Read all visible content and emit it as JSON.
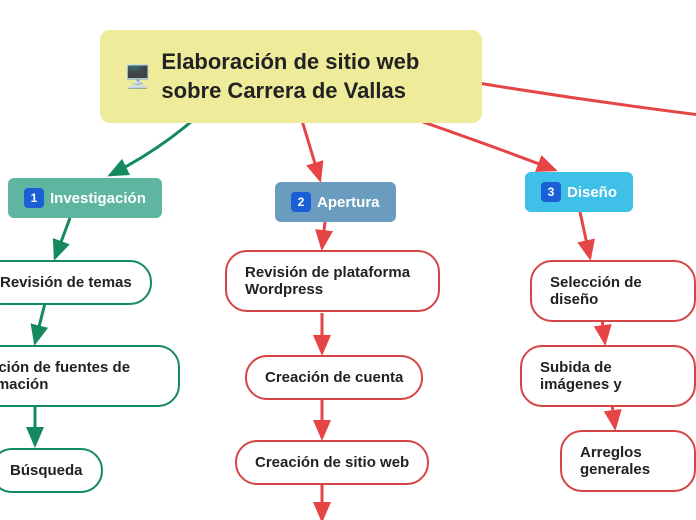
{
  "root": {
    "icon": "🖥️",
    "title": "Elaboración de sitio web sobre Carrera de Vallas"
  },
  "branches": [
    {
      "num": "1",
      "label": "Investigación"
    },
    {
      "num": "2",
      "label": "Apertura"
    },
    {
      "num": "3",
      "label": "Diseño"
    }
  ],
  "leaves_col1": [
    "Revisión de temas",
    "cción de fuentes de rmación",
    "Búsqueda"
  ],
  "leaves_col2": [
    "Revisión de plataforma Wordpress",
    "Creación de cuenta",
    "Creación de sitio web"
  ],
  "leaves_col3": [
    "Selección de diseño",
    "Subida de imágenes y",
    "Arreglos generales"
  ]
}
